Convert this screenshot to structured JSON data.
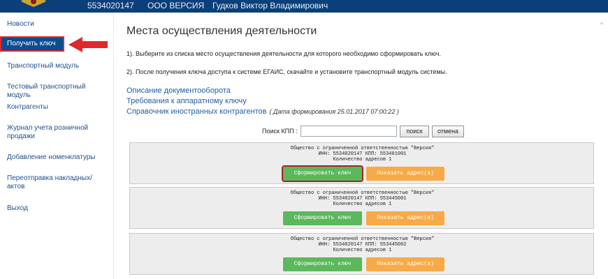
{
  "header": {
    "inn": "5534020147",
    "org": "ООО ВЕРСИЯ",
    "user": "Гудков Виктор Владимирович",
    "logo_icon": "eagle-emblem-icon"
  },
  "sidebar": {
    "items": [
      {
        "label": "Новости"
      },
      {
        "label": "Получить ключ",
        "active": true
      },
      {
        "label": "Транспортный модуль"
      },
      {
        "label": "Тестовый транспортный модуль"
      },
      {
        "label": "Контрагенты"
      },
      {
        "label": "Журнал учета розничной продажи"
      },
      {
        "label": "Добавление номенклатуры"
      },
      {
        "label": "Переотправка накладных/актов"
      },
      {
        "label": "Выход"
      }
    ]
  },
  "main": {
    "title": "Места осуществления деятельности",
    "instruction_1": "1). Выберите из списка место осуществления деятельности для которого необходимо сформировать ключ.",
    "instruction_2": "2). После получения ключа доступа к системе ЕГАИС, скачайте и установите транспортный модуль системы.",
    "links": {
      "doc_flow": "Описание документооборота",
      "key_req": "Требования к аппаратному ключу",
      "foreign": "Справочник иностранных контрагентов",
      "date_note": "( Дата формирования 25.01.2017 07:00:22 )"
    },
    "search": {
      "label": "Поиск КПП :",
      "value": "",
      "search_btn": "поиск",
      "cancel_btn": "отмена"
    },
    "cards": [
      {
        "line1": "Общество с ограниченной ответственностью \"Версия\"",
        "line2": "ИНН: 5534020147 КПП: 553401001",
        "line3": "Количество адресов 1",
        "btn_key": "Сформировать ключ",
        "btn_addr": "Показать адрес(а)"
      },
      {
        "line1": "Общество с ограниченной ответственностью \"Версия\"",
        "line2": "ИНН: 5534020147 КПП: 553445001",
        "line3": "Количество адресов 1",
        "btn_key": "Сформировать ключ",
        "btn_addr": "Показать адрес(а)"
      },
      {
        "line1": "Общество с ограниченной ответственностью \"Версия\"",
        "line2": "ИНН: 5534020147 КПП: 553445002",
        "line3": "Количество адресов 1",
        "btn_key": "Сформировать ключ",
        "btn_addr": "Показать адрес(а)"
      }
    ]
  },
  "colors": {
    "header_bg": "#0b3f7a",
    "green": "#5bb85c",
    "orange": "#f7aa47",
    "highlight_red": "#e0282a"
  }
}
